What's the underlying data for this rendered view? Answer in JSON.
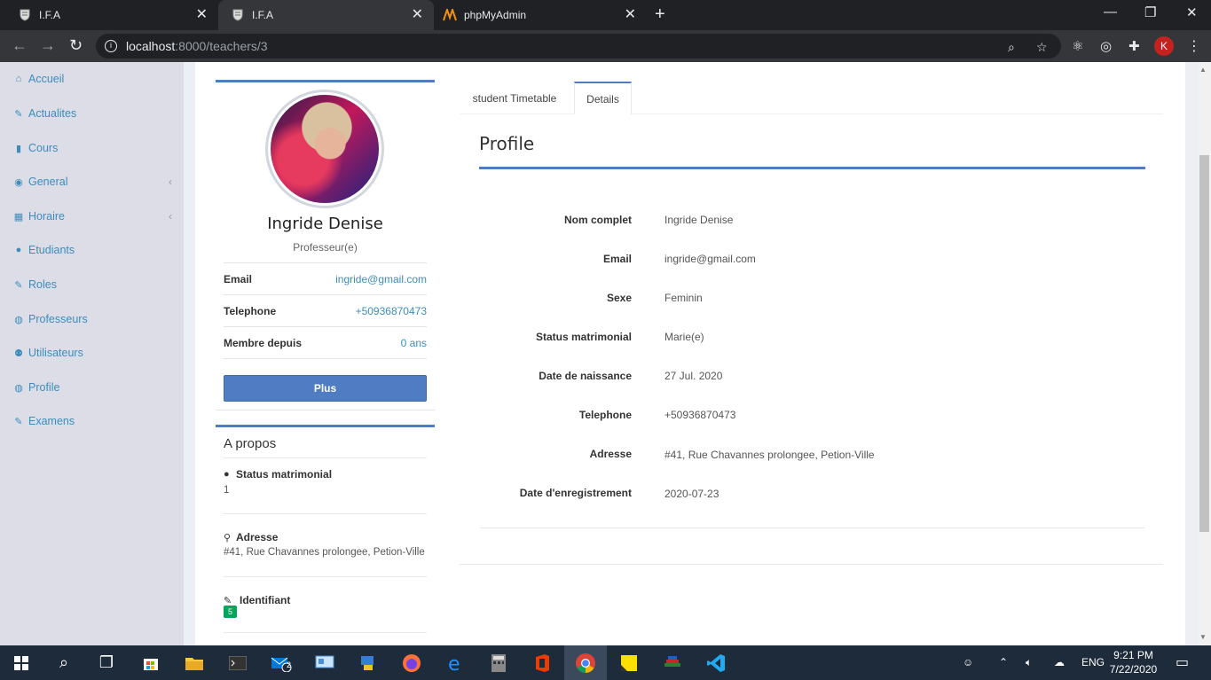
{
  "browser": {
    "tabs": [
      {
        "title": "I.F.A",
        "active": false
      },
      {
        "title": "I.F.A",
        "active": true
      },
      {
        "title": "phpMyAdmin",
        "active": false
      }
    ],
    "url_host": "localhost",
    "url_rest": ":8000/teachers/3",
    "profile_initial": "K"
  },
  "sidebar": {
    "items": [
      {
        "label": "Accueil",
        "icon": "home-icon",
        "has_chevron": false
      },
      {
        "label": "Actualites",
        "icon": "tags-icon",
        "has_chevron": false
      },
      {
        "label": "Cours",
        "icon": "book-icon",
        "has_chevron": false
      },
      {
        "label": "General",
        "icon": "gamepad-icon",
        "has_chevron": true
      },
      {
        "label": "Horaire",
        "icon": "calendar-icon",
        "has_chevron": true
      },
      {
        "label": "Etudiants",
        "icon": "user-icon",
        "has_chevron": false
      },
      {
        "label": "Roles",
        "icon": "edit-icon",
        "has_chevron": false
      },
      {
        "label": "Professeurs",
        "icon": "user-circle-icon",
        "has_chevron": false
      },
      {
        "label": "Utilisateurs",
        "icon": "users-icon",
        "has_chevron": false
      },
      {
        "label": "Profile",
        "icon": "user-circle-icon",
        "has_chevron": false
      },
      {
        "label": "Examens",
        "icon": "edit-icon",
        "has_chevron": false
      }
    ]
  },
  "profile_card": {
    "name": "Ingride Denise",
    "role": "Professeur(e)",
    "rows": [
      {
        "label": "Email",
        "value": "ingride@gmail.com"
      },
      {
        "label": "Telephone",
        "value": "+50936870473"
      },
      {
        "label": "Membre depuis",
        "value": "0 ans"
      }
    ],
    "button_label": "Plus"
  },
  "apropos": {
    "title": "A propos",
    "items": [
      {
        "label": "Status matrimonial",
        "value": "1",
        "icon": "user-icon"
      },
      {
        "label": "Adresse",
        "value": "#41, Rue Chavannes prolongee, Petion-Ville",
        "icon": "map-marker-icon"
      },
      {
        "label": "Identifiant",
        "value": "5",
        "icon": "pencil-icon"
      }
    ]
  },
  "details": {
    "tabs": [
      {
        "label": "student Timetable",
        "active": false
      },
      {
        "label": "Details",
        "active": true
      }
    ],
    "title": "Profile",
    "rows": [
      {
        "label": "Nom complet",
        "value": "Ingride Denise"
      },
      {
        "label": "Email",
        "value": "ingride@gmail.com"
      },
      {
        "label": "Sexe",
        "value": "Feminin"
      },
      {
        "label": "Status matrimonial",
        "value": "Marie(e)"
      },
      {
        "label": "Date de naissance",
        "value": "27 Jul. 2020"
      },
      {
        "label": "Telephone",
        "value": "+50936870473"
      },
      {
        "label": "Adresse",
        "value": "#41, Rue Chavannes prolongee, Petion-Ville"
      },
      {
        "label": "Date d'enregistrement",
        "value": "2020-07-23"
      }
    ]
  },
  "taskbar": {
    "mail_badge": "2",
    "language": "ENG",
    "time": "9:21 PM",
    "date": "7/22/2020"
  },
  "colors": {
    "accent": "#4f7cc2",
    "link": "#3c8dbc",
    "sidebar_bg": "#dcdde6",
    "badge_green": "#00a65a"
  }
}
